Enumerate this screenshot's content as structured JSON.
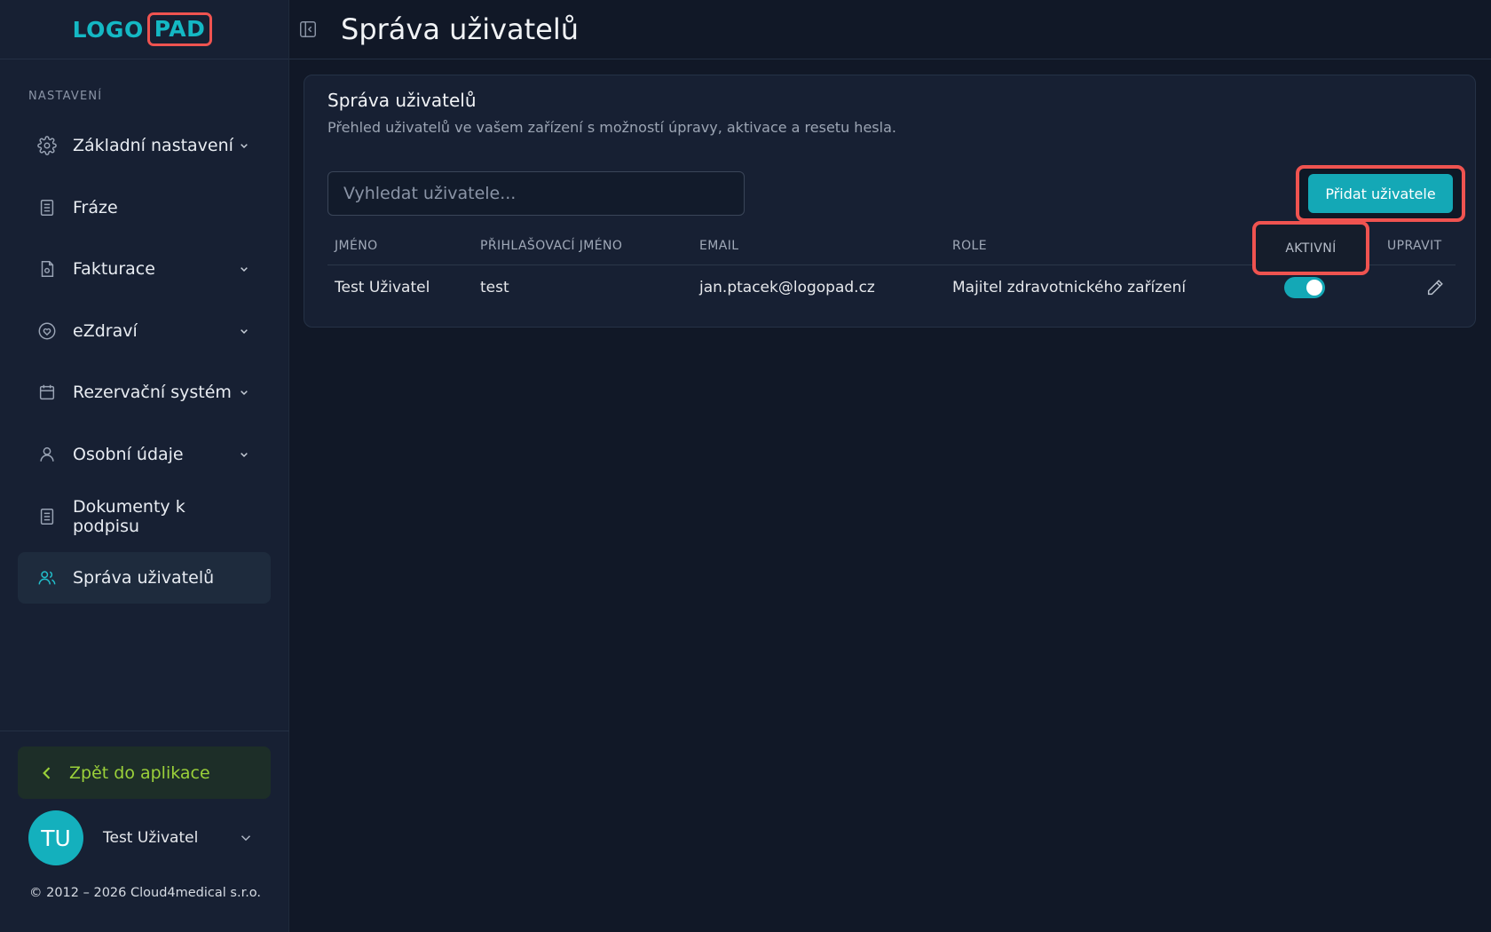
{
  "logo": {
    "part1": "LOGO",
    "part2": "PAD"
  },
  "header": {
    "title": "Správa uživatelů"
  },
  "sidebar": {
    "section_label": "NASTAVENÍ",
    "items": [
      {
        "label": "Základní nastavení",
        "icon": "gear-icon",
        "has_chevron": true
      },
      {
        "label": "Fráze",
        "icon": "document-icon",
        "has_chevron": false
      },
      {
        "label": "Fakturace",
        "icon": "invoice-icon",
        "has_chevron": true
      },
      {
        "label": "eZdraví",
        "icon": "heart-icon",
        "has_chevron": true
      },
      {
        "label": "Rezervační systém",
        "icon": "calendar-icon",
        "has_chevron": true
      },
      {
        "label": "Osobní údaje",
        "icon": "user-icon",
        "has_chevron": true
      },
      {
        "label": "Dokumenty k podpisu",
        "icon": "document-icon",
        "has_chevron": false
      },
      {
        "label": "Správa uživatelů",
        "icon": "users-icon",
        "has_chevron": false,
        "active": true
      }
    ],
    "back_label": "Zpět do aplikace",
    "user": {
      "initials": "TU",
      "name": "Test Uživatel"
    },
    "copyright": "© 2012 – 2026 Cloud4medical s.r.o."
  },
  "card": {
    "title": "Správa uživatelů",
    "subtitle": "Přehled uživatelů ve vašem zařízení s možností úpravy, aktivace a resetu hesla.",
    "search_placeholder": "Vyhledat uživatele...",
    "add_button": "Přidat uživatele"
  },
  "table": {
    "headers": {
      "name": "JMÉNO",
      "login": "PŘIHLAŠOVACÍ JMÉNO",
      "email": "EMAIL",
      "role": "ROLE",
      "active": "AKTIVNÍ",
      "edit": "UPRAVIT"
    },
    "rows": [
      {
        "name": "Test Uživatel",
        "login": "test",
        "email": "jan.ptacek@logopad.cz",
        "role": "Majitel zdravotnického zařízení",
        "active": true
      }
    ]
  },
  "colors": {
    "accent": "#14a8b6",
    "highlight": "#ef5350",
    "back_button_text": "#9bd13a"
  }
}
